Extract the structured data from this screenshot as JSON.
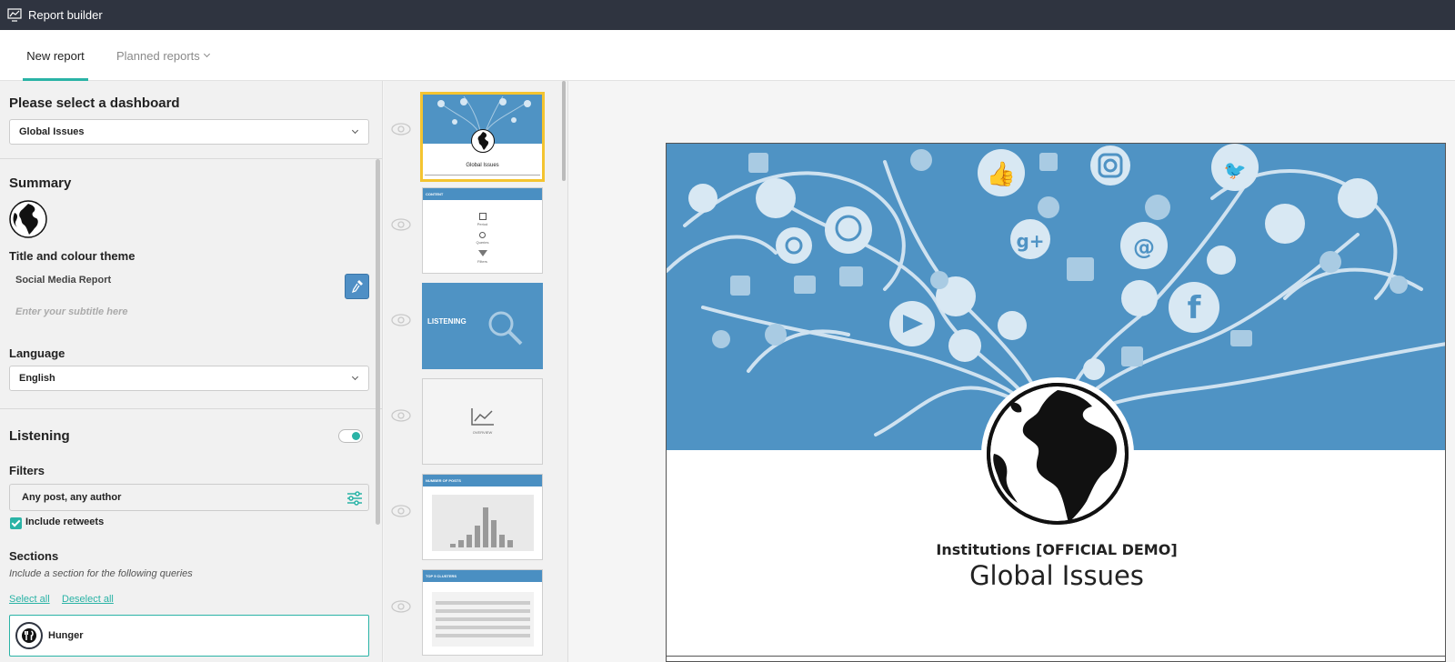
{
  "app": {
    "title": "Report builder",
    "icon": "chart-icon"
  },
  "tabs": [
    {
      "label": "New report",
      "active": true
    },
    {
      "label": "Planned reports",
      "active": false
    }
  ],
  "dashboard": {
    "heading": "Please select a dashboard",
    "selected": "Global Issues"
  },
  "summary": {
    "heading": "Summary",
    "title_theme_label": "Title and colour theme",
    "title_value": "Social Media Report",
    "subtitle_placeholder": "Enter your subtitle here",
    "language_label": "Language",
    "language_value": "English",
    "theme_color": "#4f8fc5"
  },
  "listening": {
    "heading": "Listening",
    "enabled": true,
    "filters_label": "Filters",
    "filters_value": "Any post, any author",
    "include_retweets_label": "Include retweets",
    "include_retweets": true,
    "sections_label": "Sections",
    "sections_note": "Include a section for the following queries",
    "select_all": "Select all",
    "deselect_all": "Deselect all",
    "queries": [
      {
        "label": "Hunger",
        "icon": "fork-knife-icon"
      }
    ]
  },
  "thumbnails": [
    {
      "kind": "cover",
      "caption": "Global Issues",
      "selected": true
    },
    {
      "kind": "content",
      "title": "CONTENT",
      "items": [
        "Period",
        "Queries",
        "Filters"
      ]
    },
    {
      "kind": "section",
      "title": "LISTENING"
    },
    {
      "kind": "overview",
      "caption": "OVERVIEW"
    },
    {
      "kind": "chart",
      "title": "NUMBER OF POSTS"
    },
    {
      "kind": "table",
      "title": "TOP 5 CLUSTERS"
    }
  ],
  "preview": {
    "organization": "Institutions [OFFICIAL DEMO]",
    "title": "Global Issues",
    "hero_color": "#4f93c4"
  },
  "colors": {
    "accent": "#2ab3a6",
    "topbar": "#2f3440",
    "selected_thumb": "#f4c430"
  }
}
